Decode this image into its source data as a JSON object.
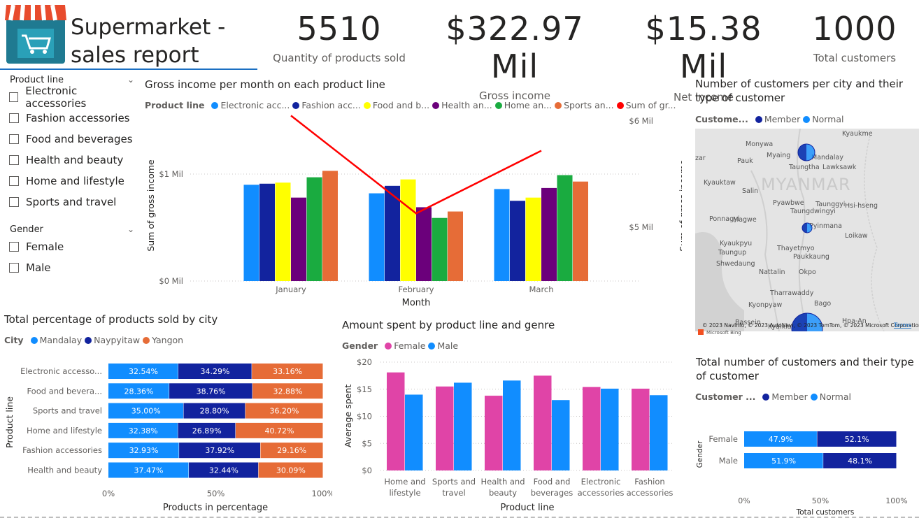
{
  "header": {
    "title_line1": "Supermarket -",
    "title_line2": "sales report",
    "logo_icon": "shopping-cart-store-icon"
  },
  "kpis": [
    {
      "value": "5510",
      "label": "Quantity of products sold"
    },
    {
      "value": "$322.97 Mil",
      "label": "Gross income"
    },
    {
      "value": "$15.38 Mil",
      "label": "Net income"
    },
    {
      "value": "1000",
      "label": "Total customers"
    }
  ],
  "slicers": {
    "product_line": {
      "title": "Product line",
      "items": [
        "Electronic accessories",
        "Fashion accessories",
        "Food and beverages",
        "Health and beauty",
        "Home and lifestyle",
        "Sports and travel"
      ]
    },
    "gender": {
      "title": "Gender",
      "items": [
        "Female",
        "Male"
      ]
    }
  },
  "colors": {
    "electronic": "#118DFF",
    "fashion": "#12239E",
    "food": "#FFFF00",
    "health": "#6B007B",
    "home": "#1AAB40",
    "sports": "#E66C37",
    "sum_line": "#FF0000",
    "mandalay": "#118DFF",
    "naypyitaw": "#12239E",
    "yangon": "#E66C37",
    "female": "#E044A7",
    "male": "#118DFF",
    "member": "#12239E",
    "normal": "#118DFF"
  },
  "gross_chart": {
    "title": "Gross income per month on each product line",
    "legend_title": "Product line",
    "legend_items": [
      "Electronic acc...",
      "Fashion acc...",
      "Food and b...",
      "Health an...",
      "Home an...",
      "Sports an...",
      "Sum of gr..."
    ],
    "y_title": "Sum of gross income",
    "y2_title": "Sum of gross income",
    "x_title": "Month",
    "y_ticks": [
      "$0 Mil",
      "$1 Mil"
    ],
    "y2_ticks": [
      "$5 Mil",
      "$6 Mil"
    ],
    "chart_data": {
      "type": "bar",
      "categories": [
        "January",
        "February",
        "March"
      ],
      "series": [
        {
          "name": "Electronic acc...",
          "values": [
            0.9,
            0.82,
            0.86
          ]
        },
        {
          "name": "Fashion acc...",
          "values": [
            0.91,
            0.89,
            0.75
          ]
        },
        {
          "name": "Food and b...",
          "values": [
            0.92,
            0.95,
            0.78
          ]
        },
        {
          "name": "Health an...",
          "values": [
            0.78,
            0.69,
            0.87
          ]
        },
        {
          "name": "Home an...",
          "values": [
            0.97,
            0.59,
            0.99
          ]
        },
        {
          "name": "Sports an...",
          "values": [
            1.03,
            0.65,
            0.93
          ]
        }
      ],
      "line": {
        "name": "Sum of gr...",
        "values": [
          6.05,
          5.13,
          5.72
        ]
      },
      "ylim": [
        0,
        1.2
      ],
      "y2lim": [
        5.08,
        6.2
      ]
    }
  },
  "city_customers": {
    "title": "Number of customers per city and their type of customer",
    "legend_title": "Custome...",
    "legend_items": [
      "Member",
      "Normal"
    ],
    "map_labels": [
      "Kyaukme",
      "Monywa",
      "Myaing",
      "Mandalay",
      "Pauk",
      "Taungtha",
      "Lawksawk",
      "Kyauktaw",
      "Salin",
      "MYANMAR",
      "Taunggyi",
      "Hsi-hseng",
      "Ponnagyi",
      "Pyawbwe",
      "Taungdwingyi",
      "Magwe",
      "Loikaw",
      "Kyaukpyu",
      "Taungup",
      "Thayetmyo",
      "Shwedaung",
      "Paukkaung",
      "Nattalin",
      "Okpo",
      "Tharrawaddy",
      "Kyonpyaw",
      "Bago",
      "Bassein",
      "Hpa-An",
      "Kyaiklat",
      "zar",
      "Pyinmana"
    ],
    "attribution": "© 2023 NavInfo, © 2023 AutoNavi, © 2023 TomTom, © 2023 Microsoft Corporation",
    "bing_label": "Microsoft Bing",
    "terms": "Terms"
  },
  "city_pct": {
    "title": "Total percentage of products sold by city",
    "legend_title": "City",
    "legend_items": [
      "Mandalay",
      "Naypyitaw",
      "Yangon"
    ],
    "y_title": "Product line",
    "x_title": "Products in percentage",
    "x_ticks": [
      "0%",
      "50%",
      "100%"
    ],
    "chart_data": {
      "type": "bar",
      "orientation": "horizontal-100%-stacked",
      "categories": [
        "Electronic accesso...",
        "Food and bevera...",
        "Sports and travel",
        "Home and lifestyle",
        "Fashion accessories",
        "Health and beauty"
      ],
      "series": [
        {
          "name": "Mandalay",
          "values": [
            32.54,
            28.36,
            35.0,
            32.38,
            32.93,
            37.47
          ],
          "labels": [
            "32.54%",
            "28.36%",
            "35.00%",
            "32.38%",
            "32.93%",
            "37.47%"
          ]
        },
        {
          "name": "Naypyitaw",
          "values": [
            34.29,
            38.76,
            28.8,
            26.89,
            37.92,
            32.44
          ],
          "labels": [
            "34.29%",
            "38.76%",
            "28.80%",
            "26.89%",
            "37.92%",
            "32.44%"
          ]
        },
        {
          "name": "Yangon",
          "values": [
            33.16,
            32.88,
            36.2,
            40.72,
            29.16,
            30.09
          ],
          "labels": [
            "33.16%",
            "32.88%",
            "36.20%",
            "40.72%",
            "29.16%",
            "30.09%"
          ]
        }
      ]
    }
  },
  "amount_spent": {
    "title": "Amount spent by product line and genre",
    "legend_title": "Gender",
    "legend_items": [
      "Female",
      "Male"
    ],
    "y_title": "Average spent",
    "x_title": "Product line",
    "y_ticks": [
      "$0",
      "$5",
      "$10",
      "$15",
      "$20"
    ],
    "chart_data": {
      "type": "bar",
      "categories": [
        [
          "Home and",
          "lifestyle"
        ],
        [
          "Sports and",
          "travel"
        ],
        [
          "Health and",
          "beauty"
        ],
        [
          "Food and",
          "beverages"
        ],
        [
          "Electronic",
          "accessories"
        ],
        [
          "Fashion",
          "accessories"
        ]
      ],
      "series": [
        {
          "name": "Female",
          "values": [
            18.1,
            15.5,
            13.8,
            17.5,
            15.4,
            15.1
          ]
        },
        {
          "name": "Male",
          "values": [
            14.0,
            16.2,
            16.6,
            13.0,
            15.1,
            13.9
          ]
        }
      ],
      "ylim": [
        0,
        20
      ]
    }
  },
  "customer_type": {
    "title": "Total number of customers and their type of customer",
    "legend_title": "Customer ...",
    "legend_items": [
      "Member",
      "Normal"
    ],
    "y_title": "Gender",
    "x_title": "Total customers",
    "x_ticks": [
      "0%",
      "50%",
      "100%"
    ],
    "chart_data": {
      "type": "bar",
      "orientation": "horizontal-100%-stacked",
      "categories": [
        "Female",
        "Male"
      ],
      "series": [
        {
          "name": "Normal",
          "values": [
            47.9,
            51.9
          ],
          "labels": [
            "47.9%",
            "51.9%"
          ]
        },
        {
          "name": "Member",
          "values": [
            52.1,
            48.1
          ],
          "labels": [
            "52.1%",
            "48.1%"
          ]
        }
      ]
    }
  }
}
